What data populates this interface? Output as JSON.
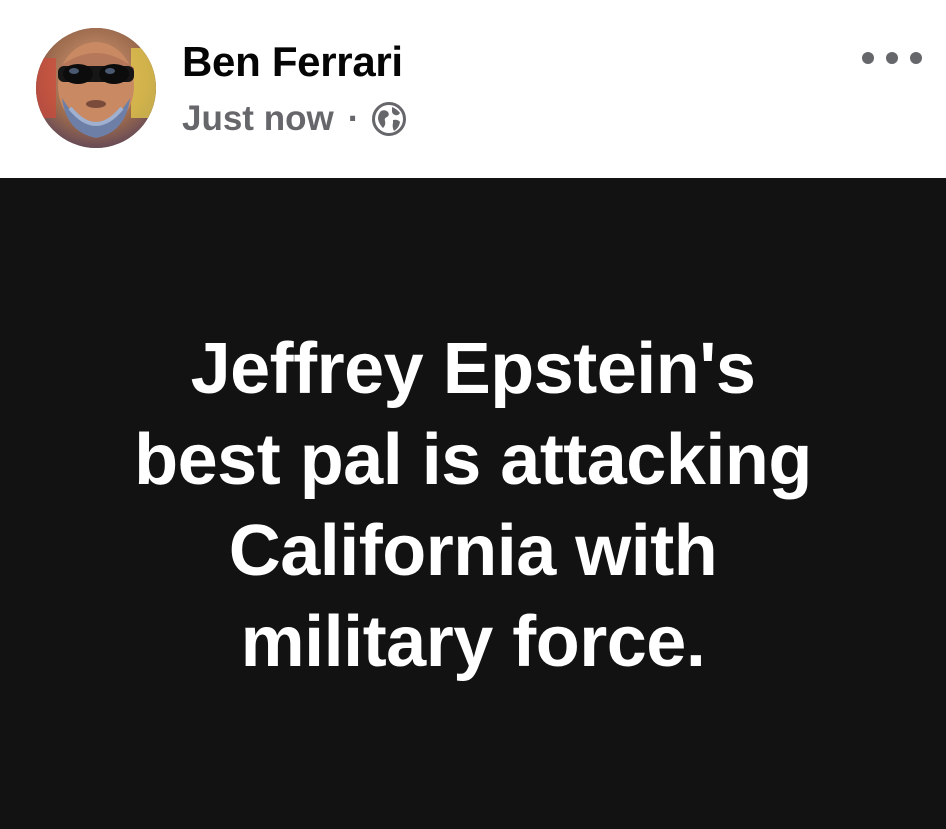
{
  "post": {
    "author_name": "Ben Ferrari",
    "timestamp": "Just now",
    "separator": "·",
    "audience_icon": "globe-icon",
    "more_icon": "more-options-icon",
    "avatar_icon": "profile-photo",
    "text_lines": [
      "Jeffrey Epstein's",
      "best pal is attacking",
      "California with",
      "military force."
    ]
  },
  "colors": {
    "card_background": "#121212",
    "card_text": "#ffffff",
    "name_text": "#050505",
    "secondary_text": "#65676b"
  }
}
